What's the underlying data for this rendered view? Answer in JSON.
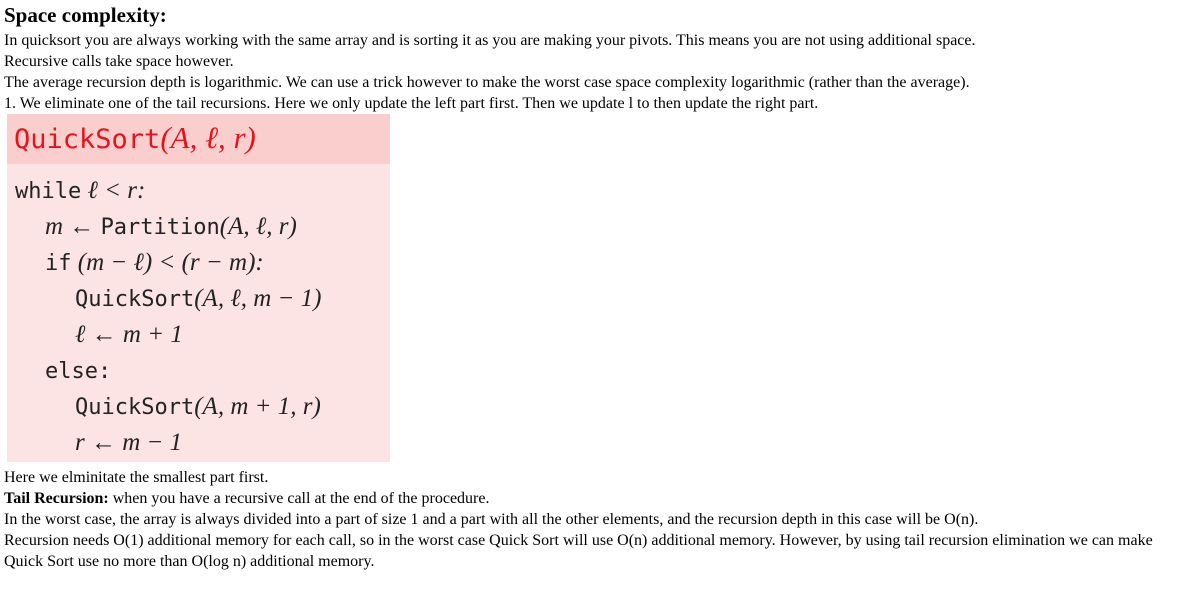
{
  "heading": "Space complexity:",
  "intro": [
    "In quicksort you are always working with the same array and is sorting it as you are making your pivots. This means you are not using additional space.",
    "Recursive calls take space however.",
    "The average recursion depth is logarithmic. We can use a trick however to make the worst case space complexity logarithmic (rather than the average).",
    "1. We eliminate one of the tail recursions. Here we only update the left part first. Then we update l to then update the right part."
  ],
  "algorithm": {
    "name": "QuickSort",
    "params": "(A, ℓ, r)",
    "kw_while": "while",
    "while_cond": "ℓ < r:",
    "m_assign": "m ←",
    "partition": "Partition",
    "partition_args": "(A, ℓ, r)",
    "kw_if": "if",
    "if_cond": "(m − ℓ) < (r − m):",
    "call_left": "QuickSort",
    "call_left_args": "(A, ℓ, m − 1)",
    "l_update": "ℓ ← m + 1",
    "kw_else": "else:",
    "call_right": "QuickSort",
    "call_right_args": "(A, m + 1, r)",
    "r_update": "r ← m − 1"
  },
  "after": {
    "line1": "Here we elminitate the smallest part first.",
    "tail_label": "Tail Recursion:",
    "tail_text": " when you have a recursive call at the end of the procedure.",
    "line3": "In the worst case, the array is always divided into a part of size 1 and a part with all the other elements, and the recursion depth in this case will be O(n).",
    "line4": "Recursion needs O(1) additional memory for each call, so in the worst case Quick Sort will use O(n) additional memory. However, by using tail recursion elimination we can make Quick Sort use no more than O(log n) additional memory."
  },
  "colors": {
    "title_red": "#e3141b",
    "box_bg": "#fde4e4",
    "header_bg": "#fbcece"
  }
}
